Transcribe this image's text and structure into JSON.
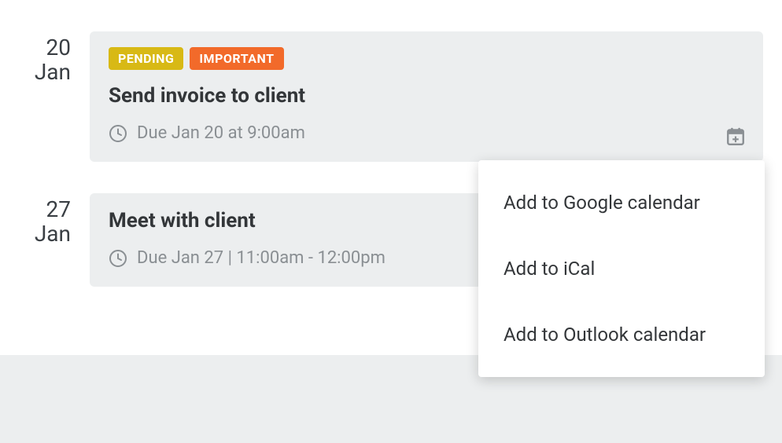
{
  "events": [
    {
      "date_day": "20",
      "date_month": "Jan",
      "badges": [
        {
          "label": "PENDING",
          "variant": "pending"
        },
        {
          "label": "IMPORTANT",
          "variant": "important"
        }
      ],
      "title": "Send invoice to client",
      "due_text": "Due Jan 20 at 9:00am",
      "show_calendar_trigger": true
    },
    {
      "date_day": "27",
      "date_month": "Jan",
      "badges": [],
      "title": "Meet with client",
      "due_text": "Due Jan 27 | 11:00am - 12:00pm",
      "show_calendar_trigger": false
    }
  ],
  "dropdown": {
    "items": [
      "Add to Google calendar",
      "Add to iCal",
      "Add to Outlook calendar"
    ]
  },
  "colors": {
    "badge_pending": "#d8b915",
    "badge_important": "#f26a2a",
    "card_bg": "#eceeef",
    "muted_text": "#8a8f93"
  }
}
